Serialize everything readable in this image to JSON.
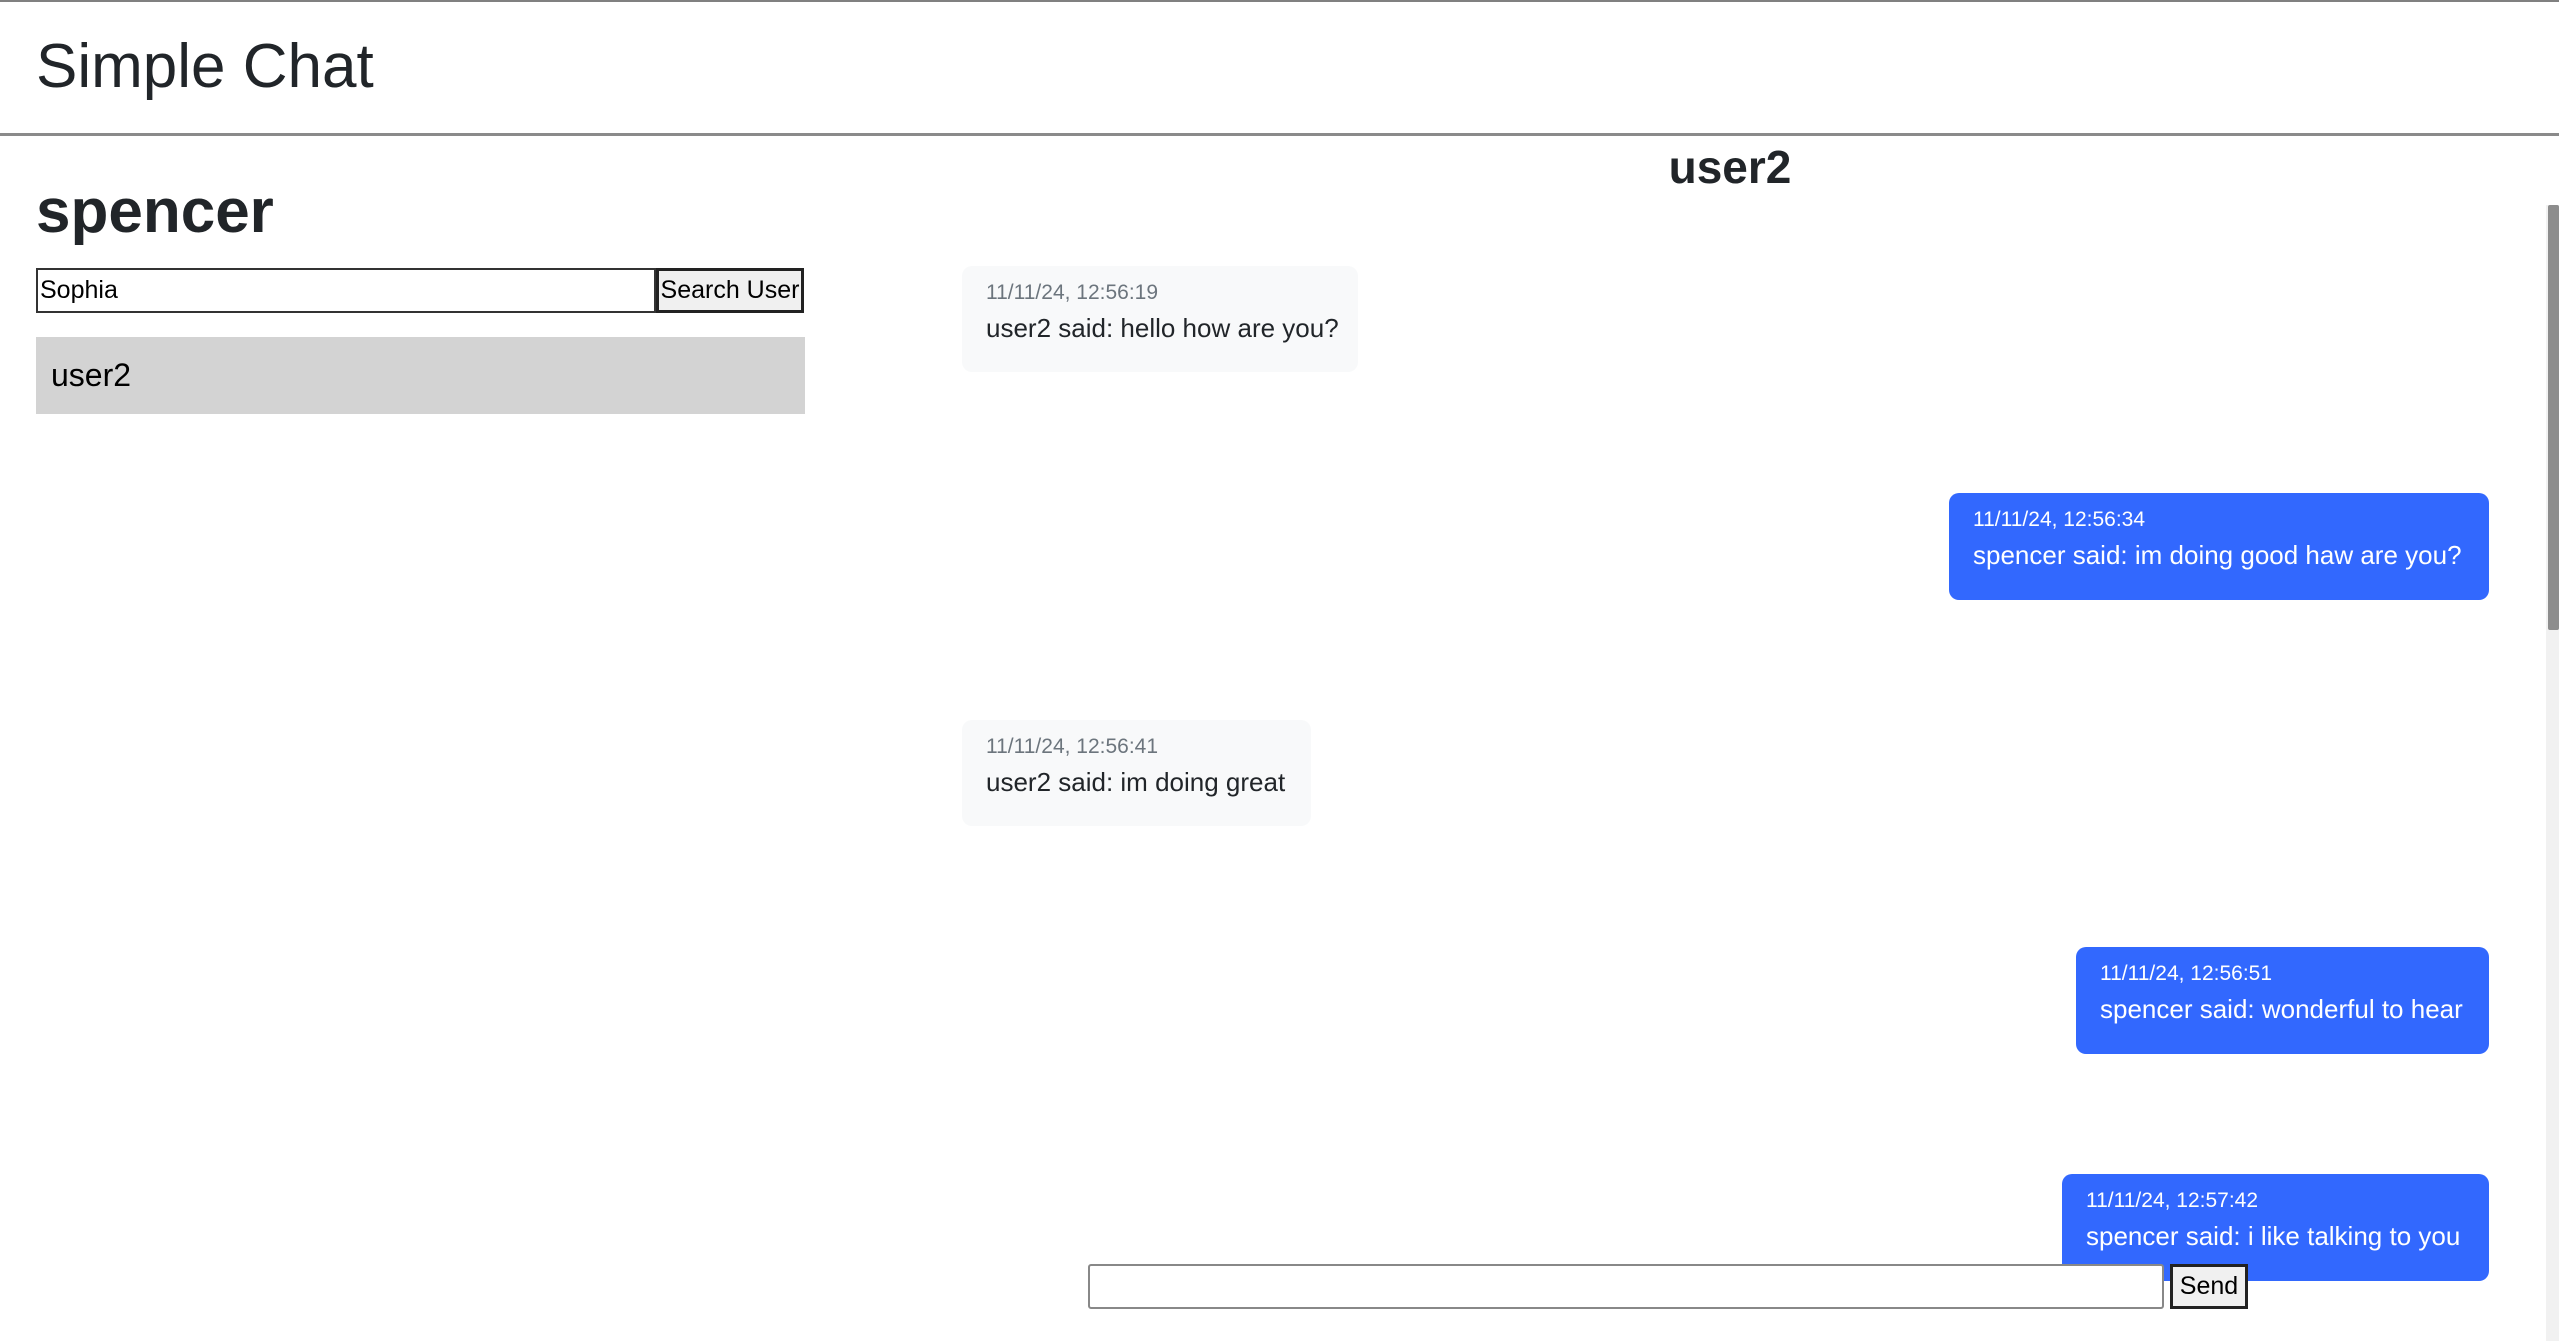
{
  "header": {
    "app_title": "Simple Chat"
  },
  "sidebar": {
    "current_user": "spencer",
    "search": {
      "value": "Sophia",
      "button_label": "Search User"
    },
    "users": [
      {
        "label": "user2"
      }
    ]
  },
  "chat": {
    "title": "user2",
    "messages": [
      {
        "direction": "received",
        "time": "11/11/24, 12:56:19",
        "text": "user2 said: hello how are you?"
      },
      {
        "direction": "sent",
        "time": "11/11/24, 12:56:34",
        "text": "spencer said: im doing good haw are you?"
      },
      {
        "direction": "received",
        "time": "11/11/24, 12:56:41",
        "text": "user2 said: im doing great"
      },
      {
        "direction": "sent",
        "time": "11/11/24, 12:56:51",
        "text": "spencer said: wonderful to hear"
      },
      {
        "direction": "sent",
        "time": "11/11/24, 12:57:42",
        "text": "spencer said: i like talking to you"
      }
    ],
    "composer": {
      "value": "",
      "send_label": "Send"
    }
  },
  "colors": {
    "sent_bubble": "#3268fe",
    "received_bubble": "#f8f9fa",
    "user_item_bg": "#d3d3d3"
  }
}
